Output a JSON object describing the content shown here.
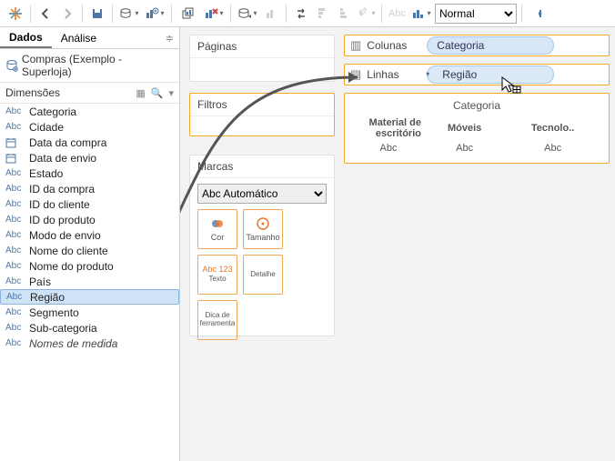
{
  "toolbar": {
    "view_mode": "Normal",
    "abc_label": "Abc"
  },
  "tabs": {
    "data": "Dados",
    "analysis": "Análise"
  },
  "datasource": {
    "name": "Compras (Exemplo - Superloja)"
  },
  "sections": {
    "dimensions": "Dimensões"
  },
  "fields": [
    {
      "type": "abc",
      "name": "Categoria"
    },
    {
      "type": "abc",
      "name": "Cidade"
    },
    {
      "type": "date",
      "name": "Data da compra"
    },
    {
      "type": "date",
      "name": "Data de envio"
    },
    {
      "type": "abc",
      "name": "Estado"
    },
    {
      "type": "abc",
      "name": "ID da compra"
    },
    {
      "type": "abc",
      "name": "ID do cliente"
    },
    {
      "type": "abc",
      "name": "ID do produto"
    },
    {
      "type": "abc",
      "name": "Modo de envio"
    },
    {
      "type": "abc",
      "name": "Nome do cliente"
    },
    {
      "type": "abc",
      "name": "Nome do produto"
    },
    {
      "type": "abc",
      "name": "País"
    },
    {
      "type": "abc",
      "name": "Região",
      "selected": true
    },
    {
      "type": "abc",
      "name": "Segmento"
    },
    {
      "type": "abc",
      "name": "Sub-categoria"
    },
    {
      "type": "abc",
      "name": "Nomes de medida",
      "italic": true
    }
  ],
  "panels": {
    "pages": "Páginas",
    "filters": "Filtros",
    "marks": "Marcas"
  },
  "marks": {
    "select": "Automático",
    "buttons": {
      "color": "Cor",
      "size": "Tamanho",
      "text": "Texto",
      "detail": "Detalhe",
      "tooltip": "Dica de ferramenta",
      "text_icon": "Abc 123"
    }
  },
  "shelves": {
    "columns_label": "Colunas",
    "rows_label": "Linhas",
    "columns_pill": "Categoria",
    "rows_pill": "Região"
  },
  "crosstab": {
    "title": "Categoria",
    "corner": "Material de escritório",
    "headers": [
      "Móveis",
      "Tecnolo.."
    ],
    "placeholder": "Abc"
  }
}
